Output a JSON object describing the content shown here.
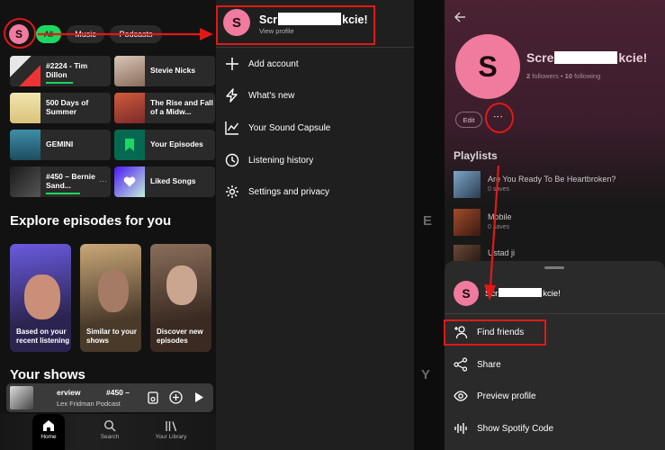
{
  "home": {
    "avatar_letter": "S",
    "chips": [
      "All",
      "Music",
      "Podcasts"
    ],
    "tiles": [
      {
        "label": "#2224 - Tim Dillon"
      },
      {
        "label": "Stevie Nicks"
      },
      {
        "label": "500 Days of Summer"
      },
      {
        "label": "The Rise and Fall of a Midw..."
      },
      {
        "label": "GEMINI"
      },
      {
        "label": "Your Episodes"
      },
      {
        "label": "#450 – Bernie Sand..."
      },
      {
        "label": "Liked Songs"
      }
    ],
    "section_episodes": "Explore episodes for you",
    "episodes": [
      "Based on your recent listening",
      "Similar to your shows",
      "Discover new episodes"
    ],
    "section_shows": "Your shows",
    "mini_player": {
      "title": "erview",
      "episode_no": "#450 –",
      "subtitle": "Lex Fridman Podcast"
    },
    "nav": [
      "Home",
      "Search",
      "Your Library"
    ]
  },
  "menu": {
    "avatar_letter": "S",
    "name_prefix": "Scr",
    "name_suffix": "kcie!",
    "view_profile": "View profile",
    "items": [
      "Add account",
      "What's new",
      "Your Sound Capsule",
      "Listening history",
      "Settings and privacy"
    ]
  },
  "profile": {
    "avatar_letter": "S",
    "name_prefix": "Scre",
    "name_suffix": "kcie!",
    "followers_count": "2",
    "followers_label": "followers",
    "following_count": "10",
    "following_label": "following",
    "edit_label": "Edit",
    "playlists_heading": "Playlists",
    "playlists": [
      {
        "title": "Are You Ready To Be Heartbroken?",
        "meta": "0 saves"
      },
      {
        "title": "Mobile",
        "meta": "0 saves"
      },
      {
        "title": "Ustad ji",
        "meta": ""
      }
    ],
    "sheet": {
      "avatar_letter": "S",
      "name_prefix": "Scr",
      "name_suffix": "kcie!",
      "items": [
        "Find friends",
        "Share",
        "Preview profile",
        "Show Spotify Code"
      ]
    }
  },
  "colors": {
    "accent": "#1ed760",
    "avatar": "#f07b9e",
    "annotation": "#e21818"
  }
}
